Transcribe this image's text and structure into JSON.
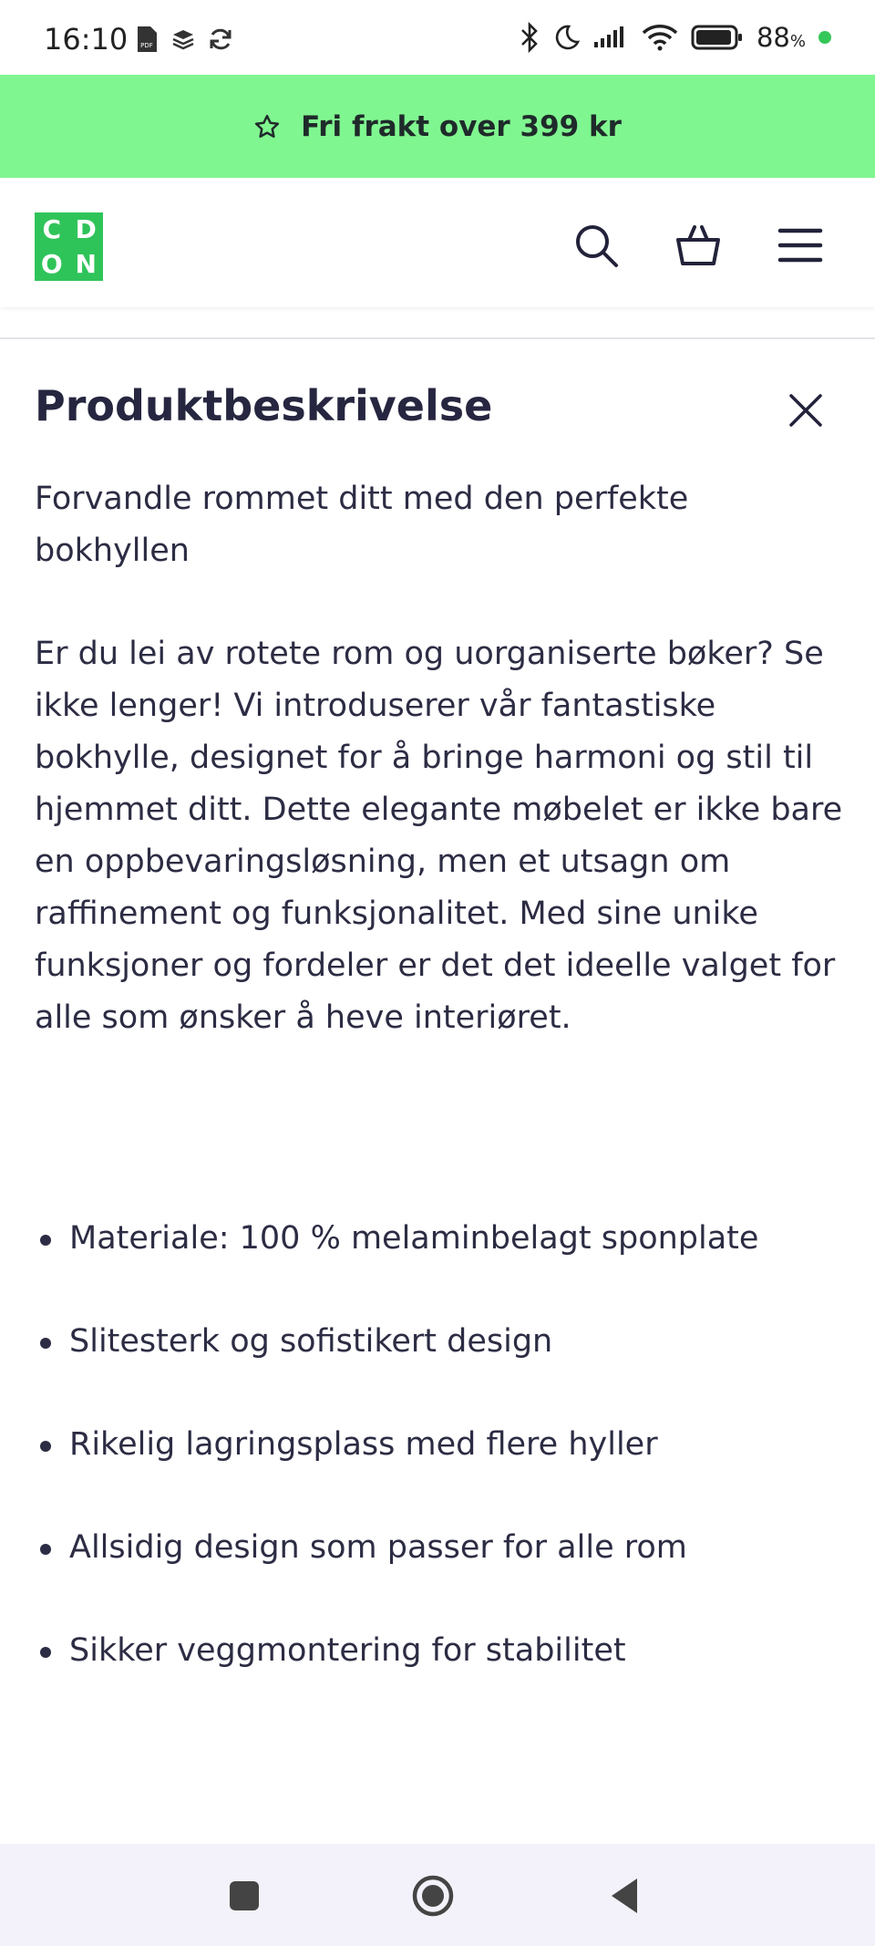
{
  "status_bar": {
    "time": "16:10",
    "battery_percent": "88",
    "battery_unit": "%",
    "left_icons": [
      "pdf-icon",
      "layers-icon",
      "sync-icon"
    ],
    "right_icons": [
      "bluetooth-icon",
      "moon-icon",
      "signal-icon",
      "wifi-icon",
      "battery-icon"
    ]
  },
  "promo": {
    "icon": "star-icon",
    "text": "Fri frakt over 399 kr",
    "background": "#80f690"
  },
  "header": {
    "logo_letters": [
      "C",
      "D",
      "O",
      "N"
    ],
    "logo_color": "#2fc45a",
    "icons": [
      "search-icon",
      "basket-icon",
      "menu-icon"
    ]
  },
  "main": {
    "title": "Produktbeskrivelse",
    "intro": "Forvandle rommet ditt med den perfekte bokhyllen",
    "body": "Er du lei av rotete rom og uorganiserte bøker? Se ikke lenger! Vi introduserer vår fantastiske bokhylle, designet for å bringe harmoni og stil til hjemmet ditt. Dette elegante møbelet er ikke bare en oppbevaringsløsning, men et utsagn om raffinement og funksjonalitet. Med sine unike funksjoner og fordeler er det det ideelle valget for alle som ønsker å heve interiøret.",
    "bullets": [
      "Materiale: 100 % melaminbelagt sponplate",
      "Slitesterk og sofistikert design",
      "Rikelig lagringsplass med flere hyller",
      "Allsidig design som passer for alle rom",
      "Sikker veggmontering for stabilitet"
    ]
  },
  "navbar": {
    "icons": [
      "recents-icon",
      "home-icon",
      "back-icon"
    ]
  }
}
